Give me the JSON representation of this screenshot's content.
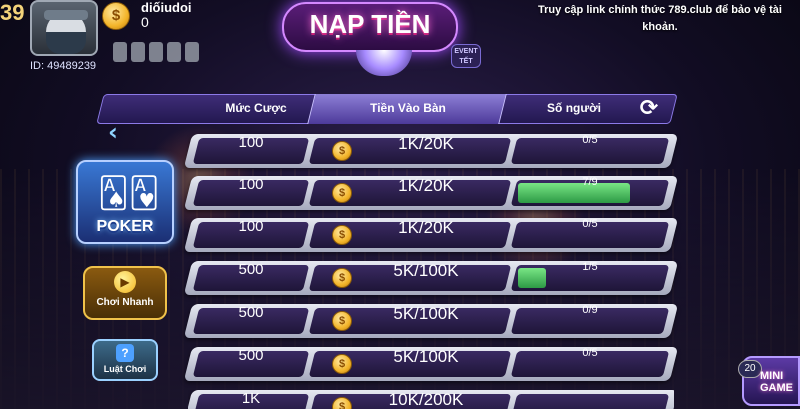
{
  "profile": {
    "level": "39",
    "username": "diốiudoi",
    "balance": "0",
    "user_id": "ID: 49489239",
    "coin_symbol": "$"
  },
  "header": {
    "title": "NẠP TIỀN",
    "event_label": "EVENT TẾT",
    "notice": "Truy cập link chính thức 789.club để bảo vệ tài khoản."
  },
  "table": {
    "columns": [
      "Mức Cược",
      "Tiền Vào Bàn",
      "Số người"
    ],
    "rows": [
      {
        "bet": "100",
        "stake": "1K/20K",
        "players": "0/5",
        "fill": 0
      },
      {
        "bet": "100",
        "stake": "1K/20K",
        "players": "7/9",
        "fill": 0.78
      },
      {
        "bet": "100",
        "stake": "1K/20K",
        "players": "0/5",
        "fill": 0
      },
      {
        "bet": "500",
        "stake": "5K/100K",
        "players": "1/5",
        "fill": 0.2
      },
      {
        "bet": "500",
        "stake": "5K/100K",
        "players": "0/9",
        "fill": 0
      },
      {
        "bet": "500",
        "stake": "5K/100K",
        "players": "0/5",
        "fill": 0
      },
      {
        "bet": "1K",
        "stake": "10K/200K",
        "players": "",
        "fill": 0
      }
    ]
  },
  "sidebar": {
    "game_name": "POKER",
    "quick_play": "Chơi Nhanh",
    "rules": "Luật Chơi"
  },
  "mini_game": {
    "count": "20",
    "label": "MINI GAME"
  }
}
